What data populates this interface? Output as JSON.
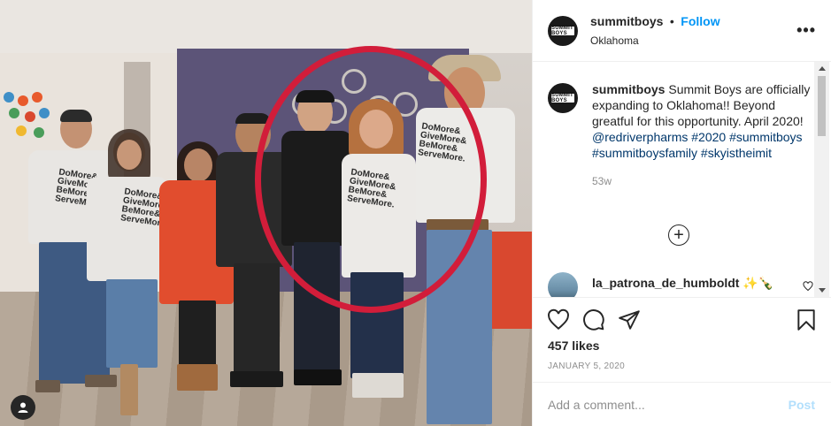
{
  "post": {
    "username": "summitboys",
    "separator": "•",
    "follow_label": "Follow",
    "location": "Oklahoma",
    "more_icon": "more-options-icon",
    "avatar_text": "SUMMIT BOYS"
  },
  "photo": {
    "shirt_text": "DoMore&\nGiveMore&\nBeMore&\nServeMore.",
    "highlight_color": "#d21d3a",
    "user_tag_icon": "user-tag-icon"
  },
  "caption": {
    "username": "summitboys",
    "text_1": "Summit Boys are officially expanding to Oklahoma!! Beyond greatful for this opportunity. April 2020!",
    "mention": "@redriverpharms",
    "tag_1": "#2020",
    "tag_2": "#summitboys",
    "tag_3": "#summitboysfamily",
    "tag_4": "#skyistheimit",
    "time": "53w"
  },
  "load_more_icon": "plus-circle-icon",
  "comments": [
    {
      "username": "la_patrona_de_humboldt",
      "emoji": "✨🍾"
    }
  ],
  "actions": {
    "like_icon": "heart-icon",
    "comment_icon": "comment-icon",
    "share_icon": "share-icon",
    "save_icon": "bookmark-icon",
    "likes": "457 likes",
    "date": "JANUARY 5, 2020"
  },
  "add_comment": {
    "placeholder": "Add a comment...",
    "post_label": "Post"
  },
  "colors": {
    "link": "#0095f6",
    "tag": "#00376b",
    "muted": "#8e8e8e"
  }
}
